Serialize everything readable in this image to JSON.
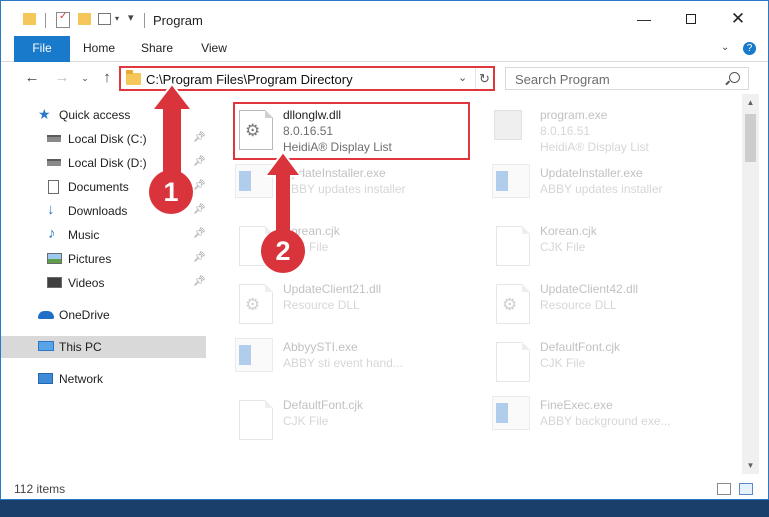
{
  "window": {
    "title": "Program"
  },
  "ribbon": {
    "tabs": [
      "File",
      "Home",
      "Share",
      "View"
    ]
  },
  "address": {
    "path": "C:\\Program Files\\Program Directory"
  },
  "search": {
    "placeholder": "Search Program"
  },
  "nav_pane": {
    "quick_access": "Quick access",
    "items": [
      {
        "label": "Local Disk (C:)",
        "icon": "drive-icon",
        "pinned": true
      },
      {
        "label": "Local Disk (D:)",
        "icon": "drive-icon",
        "pinned": true
      },
      {
        "label": "Documents",
        "icon": "documents-icon",
        "pinned": true
      },
      {
        "label": "Downloads",
        "icon": "downloads-icon",
        "pinned": true
      },
      {
        "label": "Music",
        "icon": "music-icon",
        "pinned": true
      },
      {
        "label": "Pictures",
        "icon": "pictures-icon",
        "pinned": true
      },
      {
        "label": "Videos",
        "icon": "videos-icon",
        "pinned": true
      }
    ],
    "onedrive": "OneDrive",
    "this_pc": "This PC",
    "network": "Network"
  },
  "files": [
    {
      "name": "dllonglw.dll",
      "line2": "8.0.16.51",
      "line3": "HeidiA® Display List",
      "icon": "dll-icon",
      "highlighted": true
    },
    {
      "name": "program.exe",
      "line2": "8.0.16.51",
      "line3": "HeidiA® Display List",
      "icon": "exe-icon"
    },
    {
      "name": "UpdateInstaller.exe",
      "line2": "ABBY updates installer",
      "icon": "exe-icon"
    },
    {
      "name": "UpdateInstaller.exe",
      "line2": "ABBY updates installer",
      "icon": "exe-icon"
    },
    {
      "name": "Korean.cjk",
      "line2": "CJK File",
      "icon": "file-icon"
    },
    {
      "name": "Korean.cjk",
      "line2": "CJK File",
      "icon": "file-icon"
    },
    {
      "name": "UpdateClient21.dll",
      "line2": "Resource DLL",
      "icon": "dll-icon"
    },
    {
      "name": "UpdateClient42.dll",
      "line2": "Resource DLL",
      "icon": "dll-icon"
    },
    {
      "name": "AbbyySTI.exe",
      "line2": "ABBY sti event hand...",
      "icon": "exe-icon"
    },
    {
      "name": "DefaultFont.cjk",
      "line2": "CJK File",
      "icon": "file-icon"
    },
    {
      "name": "DefaultFont.cjk",
      "line2": "CJK File",
      "icon": "file-icon"
    },
    {
      "name": "FineExec.exe",
      "line2": "ABBY background exe...",
      "icon": "exe-icon"
    }
  ],
  "status": {
    "item_count": "112 items"
  },
  "annotations": {
    "step1": "1",
    "step2": "2"
  },
  "colors": {
    "accent": "#1979ca",
    "highlight": "#e0363e",
    "badge": "#d9343b"
  }
}
